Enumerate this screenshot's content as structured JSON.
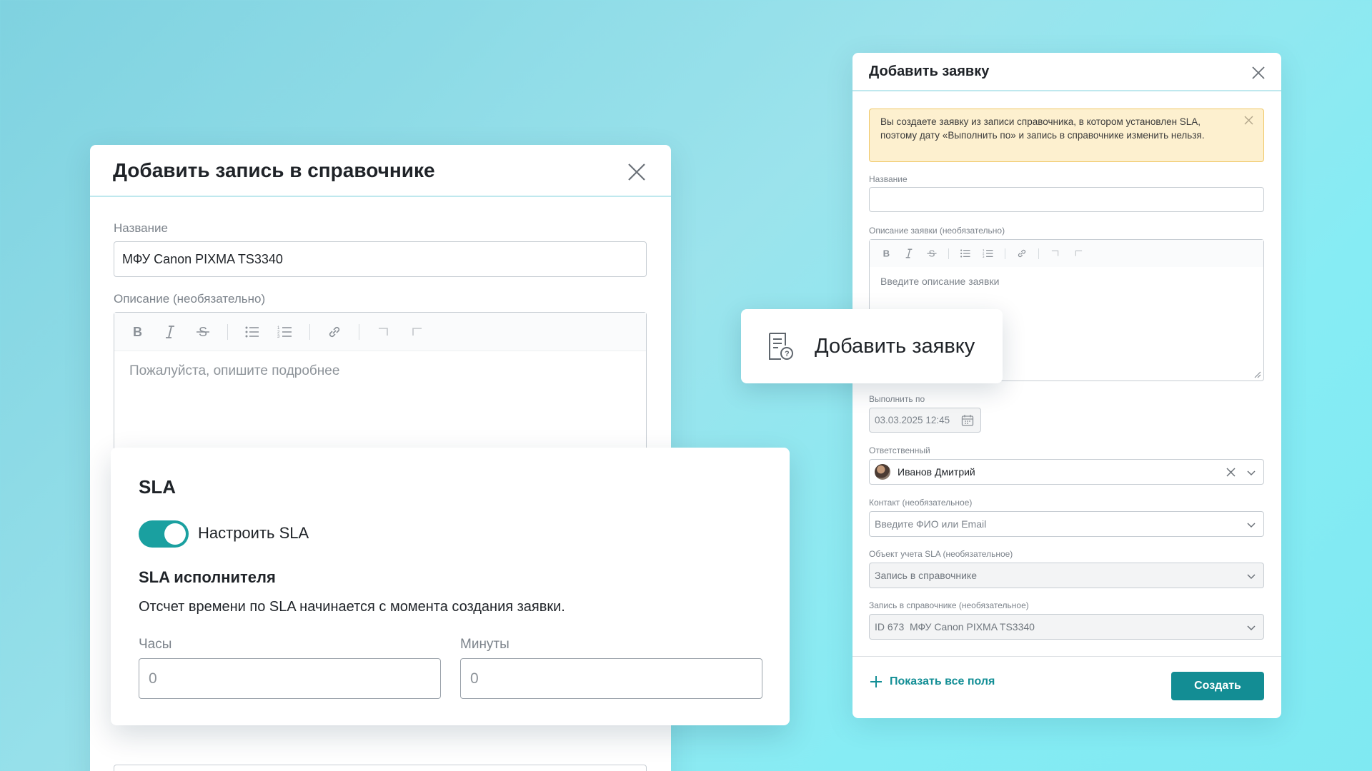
{
  "left_dialog": {
    "title": "Добавить запись в справочнике",
    "name_label": "Название",
    "name_value": "МФУ Canon PIXMA TS3340",
    "description_label": "Описание (необязательно)",
    "description_placeholder": "Пожалуйста, опишите подробнее",
    "toolbar_icons": [
      "bold-icon",
      "italic-icon",
      "strikethrough-icon",
      "bullet-list-icon",
      "numbered-list-icon",
      "link-icon",
      "undo-icon",
      "redo-icon"
    ]
  },
  "sla_card": {
    "title": "SLA",
    "toggle_label": "Настроить SLA",
    "toggle_on": true,
    "subtitle": "SLA исполнителя",
    "hint": "Отсчет времени по SLA начинается с момента создания заявки.",
    "hours_label": "Часы",
    "hours_value": "0",
    "minutes_label": "Минуты",
    "minutes_value": "0"
  },
  "right_dialog": {
    "title": "Добавить заявку",
    "warning": "Вы создаете заявку из записи справочника, в котором установлен SLA, поэтому дату «Выполнить по» и запись в справочнике изменить нельзя.",
    "name_label": "Название",
    "name_value": "",
    "description_label": "Описание заявки (необязательно)",
    "description_placeholder": "Введите описание заявки",
    "due_label": "Выполнить по",
    "due_value": "03.03.2025 12:45",
    "assignee_label": "Ответственный",
    "assignee_value": "Иванов Дмитрий",
    "contact_label": "Контакт (необязательное)",
    "contact_placeholder": "Введите ФИО или Email",
    "sla_object_label": "Объект учета SLA (необязательное)",
    "sla_object_value": "Запись в справочнике",
    "record_label": "Запись в справочнике (необязательное)",
    "record_value": "ID 673  МФУ Canon PIXMA TS3340",
    "show_all_label": "Показать все поля",
    "create_label": "Создать"
  },
  "add_chip": {
    "label": "Добавить заявку"
  },
  "colors": {
    "accent": "#138d94",
    "toggle": "#1aa0a0",
    "warning_bg": "#fdf0cf",
    "warning_border": "#f0c96a"
  }
}
